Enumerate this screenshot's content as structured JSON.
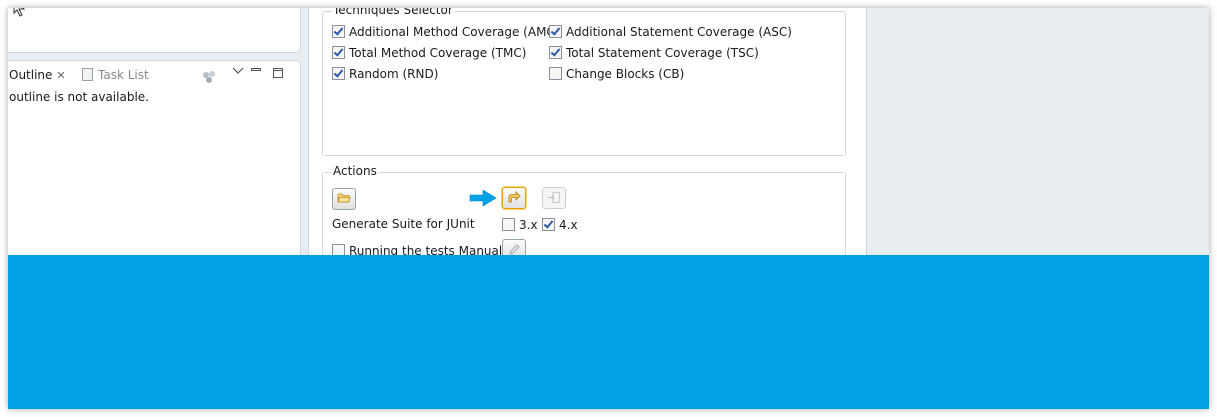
{
  "outline_view": {
    "tab_label": "Outline",
    "close_glyph": "✕",
    "task_list_label": "Task List",
    "message": "outline is not available."
  },
  "techniques": {
    "title": "Techniques Selector",
    "options": [
      {
        "label": "Additional Method Coverage (AMC)",
        "checked": true
      },
      {
        "label": "Total Method Coverage (TMC)",
        "checked": true
      },
      {
        "label": "Random (RND)",
        "checked": true
      },
      {
        "label": "Additional Statement Coverage (ASC)",
        "checked": true
      },
      {
        "label": "Total Statement Coverage (TSC)",
        "checked": true
      },
      {
        "label": "Change Blocks (CB)",
        "checked": false
      }
    ]
  },
  "actions": {
    "title": "Actions",
    "generate_label": "Generate Suite for JUnit",
    "junit3_label": "3.x",
    "junit3_checked": false,
    "junit4_label": "4.x",
    "junit4_checked": true,
    "manual_label": "Running the tests Manually",
    "manual_checked": false
  },
  "icons": {
    "open": "folder-open-icon",
    "generate": "arrow-icon",
    "export": "export-icon",
    "edit": "pencil-icon",
    "pointer": "blue-arrow-pointer-icon"
  },
  "colors": {
    "accent_blue": "#00a2e6",
    "checkbox_check": "#2a5aa8",
    "highlight_orange": "#e8a200"
  }
}
